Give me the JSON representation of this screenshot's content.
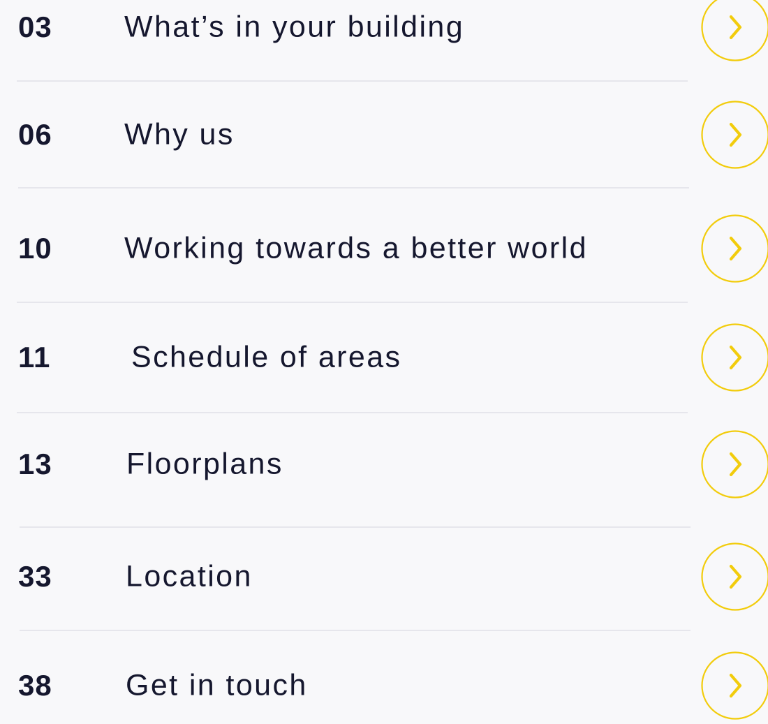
{
  "accent_color": "#f2cc0c",
  "text_color": "#15172e",
  "arrow_icon": "chevron-right-in-circle",
  "items": [
    {
      "page": "03",
      "title": "What’s in your building"
    },
    {
      "page": "06",
      "title": "Why us"
    },
    {
      "page": "10",
      "title": "Working towards a better world"
    },
    {
      "page": "11",
      "title": "Schedule of areas"
    },
    {
      "page": "13",
      "title": "Floorplans"
    },
    {
      "page": "33",
      "title": "Location"
    },
    {
      "page": "38",
      "title": "Get in touch"
    }
  ]
}
